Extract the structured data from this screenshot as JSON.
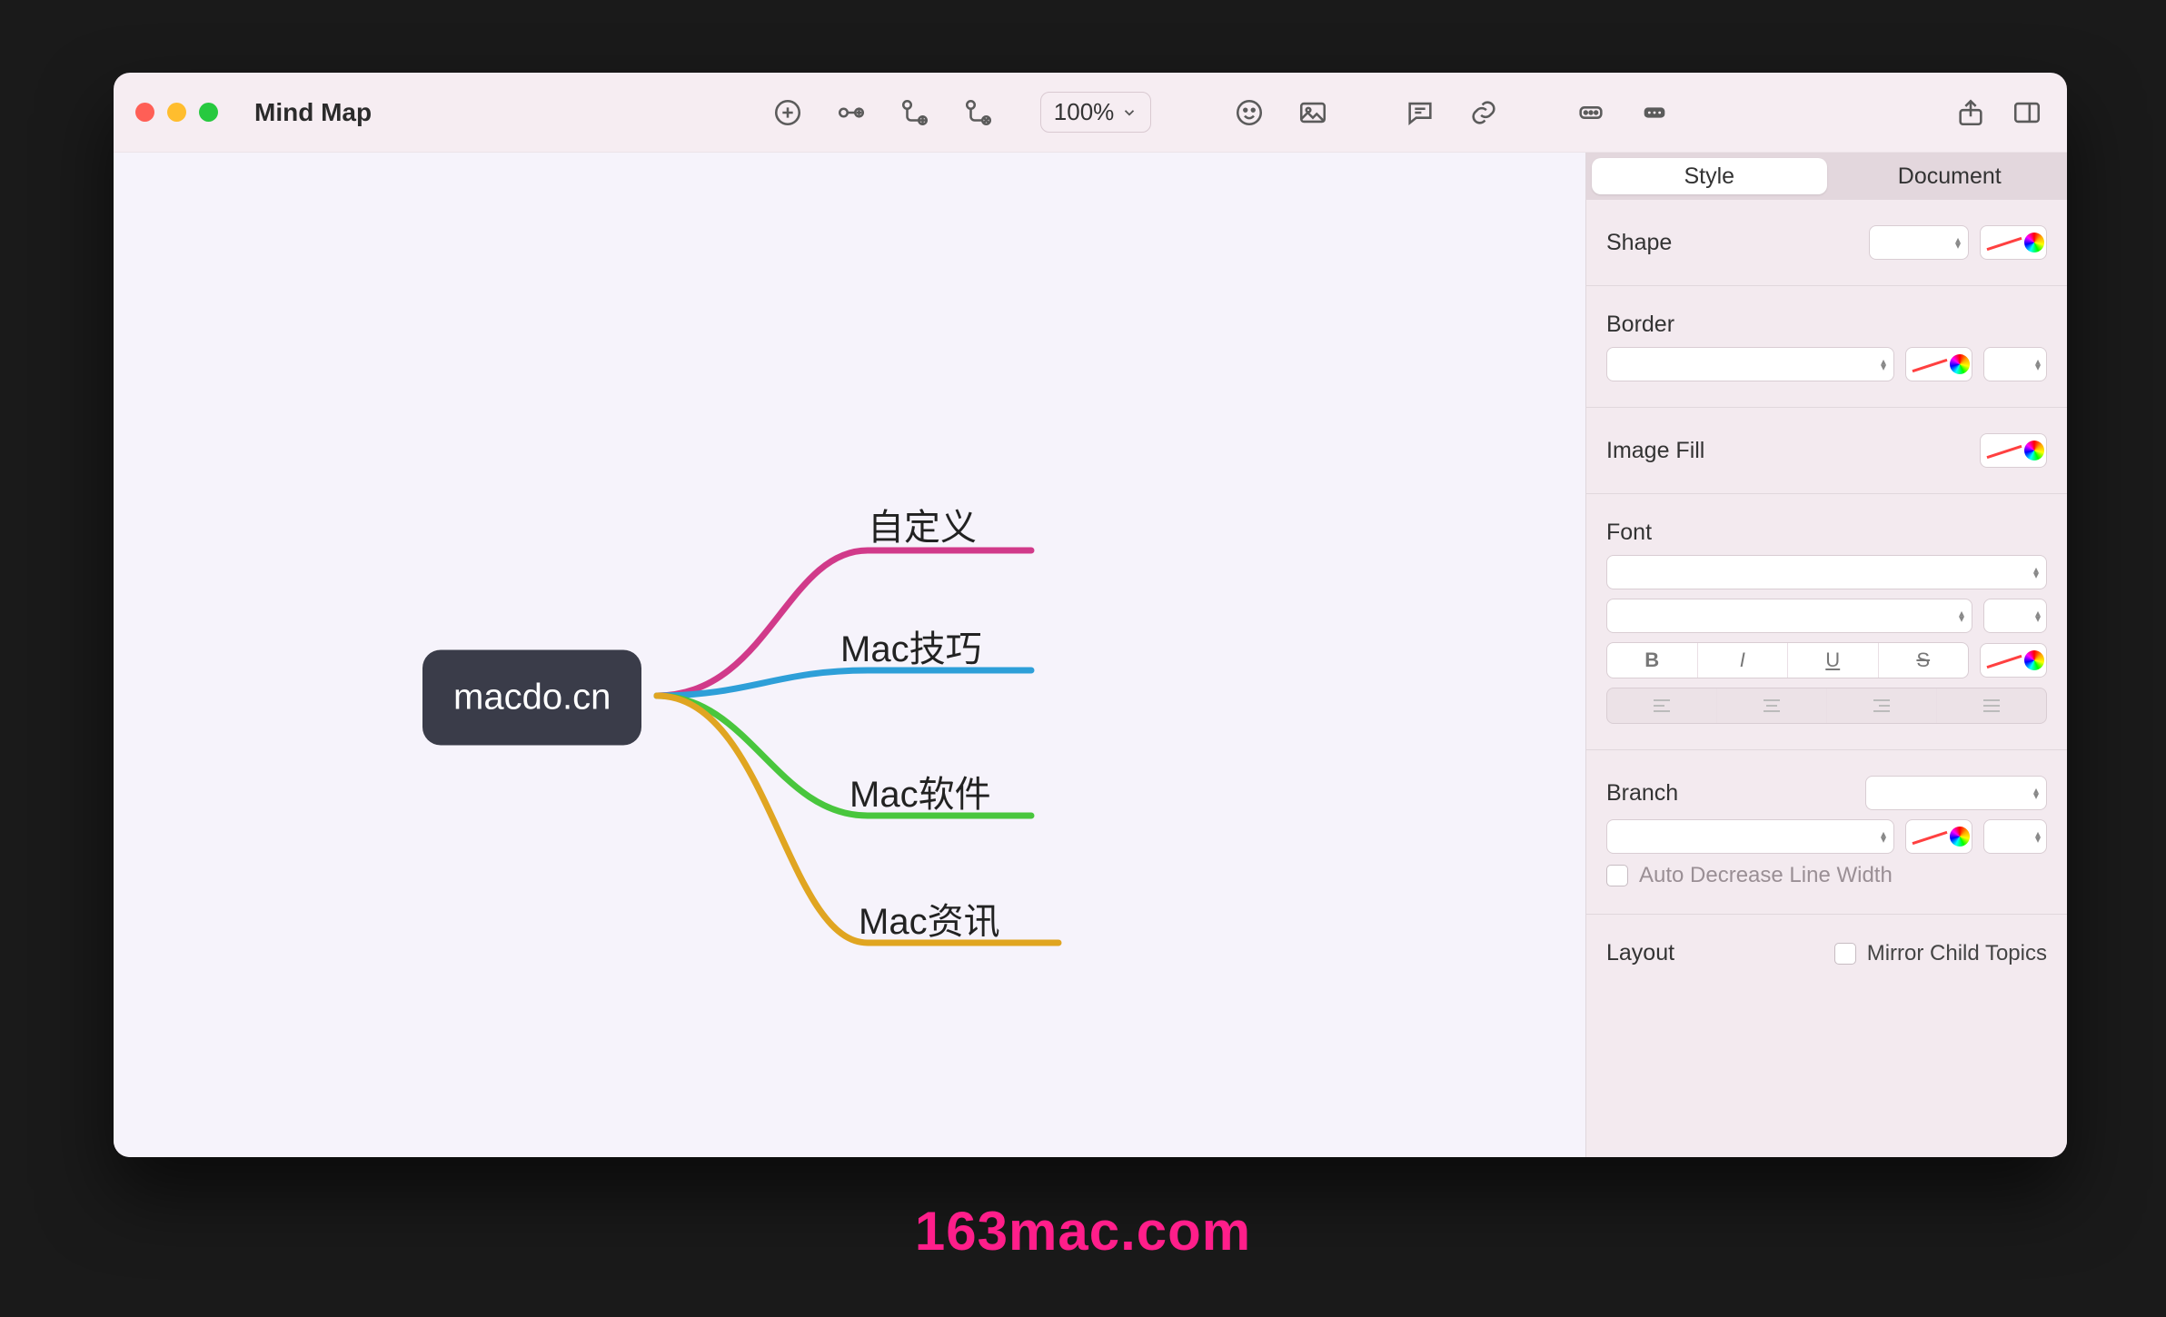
{
  "app": {
    "title": "Mind Map"
  },
  "toolbar": {
    "zoom": "100%"
  },
  "inspector": {
    "tabs": {
      "style": "Style",
      "document": "Document"
    },
    "shape_label": "Shape",
    "border_label": "Border",
    "imagefill_label": "Image Fill",
    "font_label": "Font",
    "branch_label": "Branch",
    "auto_decrease": "Auto Decrease Line Width",
    "layout_label": "Layout",
    "mirror_label": "Mirror Child Topics"
  },
  "mindmap": {
    "root": "macdo.cn",
    "children": [
      {
        "label": "自定义",
        "color": "#d13a8a"
      },
      {
        "label": "Mac技巧",
        "color": "#2e9fd8"
      },
      {
        "label": "Mac软件",
        "color": "#49c63d"
      },
      {
        "label": "Mac资讯",
        "color": "#e0a521"
      }
    ]
  },
  "watermark": "163mac.com"
}
